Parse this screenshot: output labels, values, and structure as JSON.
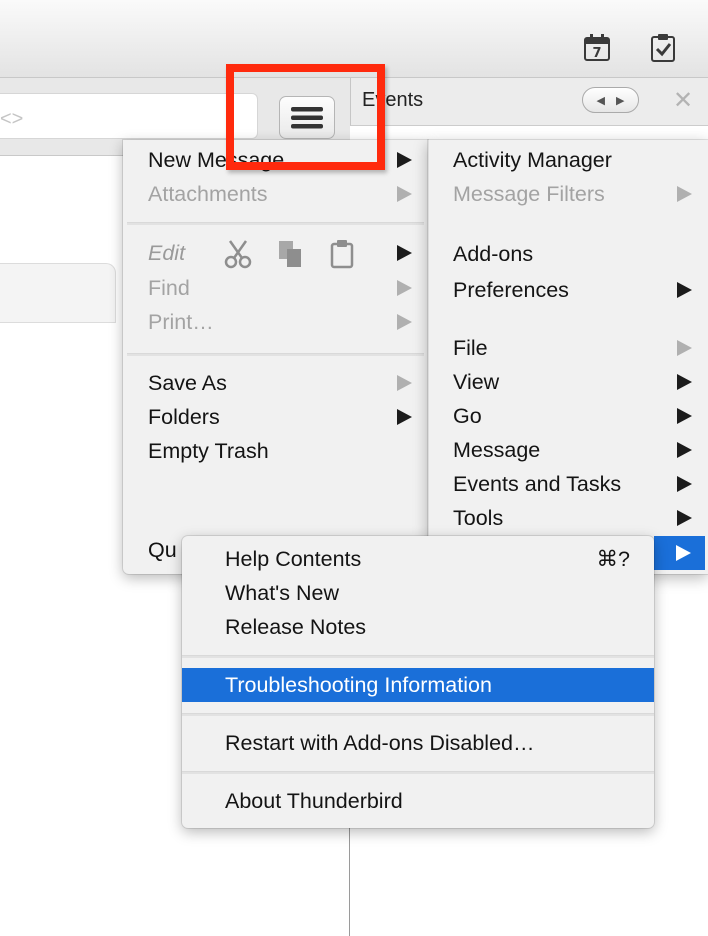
{
  "header": {
    "calendar_icon": "calendar-icon",
    "calendar_day": "7",
    "tasks_icon": "tasks-icon",
    "search_hint": "<>",
    "menu_icon": "hamburger-icon"
  },
  "events_pane": {
    "title": "Events",
    "close_icon": "close-icon"
  },
  "menu_left": {
    "new_message": "New Message",
    "attachments": "Attachments",
    "edit": "Edit",
    "find": "Find",
    "print": "Print…",
    "save_as": "Save As",
    "folders": "Folders",
    "empty_trash": "Empty Trash",
    "quit": "Qu"
  },
  "menu_right": {
    "activity_manager": "Activity Manager",
    "message_filters": "Message Filters",
    "addons": "Add-ons",
    "preferences": "Preferences",
    "file": "File",
    "view": "View",
    "go": "Go",
    "message": "Message",
    "events_and_tasks": "Events and Tasks",
    "tools": "Tools"
  },
  "menu_help": {
    "help_contents": "Help Contents",
    "help_shortcut": "⌘?",
    "whats_new": "What's New",
    "release_notes": "Release Notes",
    "troubleshooting": "Troubleshooting Information",
    "restart_addons_disabled": "Restart with Add-ons Disabled…",
    "about": "About Thunderbird"
  },
  "colors": {
    "selection": "#1a6fd9",
    "highlight_box": "#ff2a0d"
  }
}
